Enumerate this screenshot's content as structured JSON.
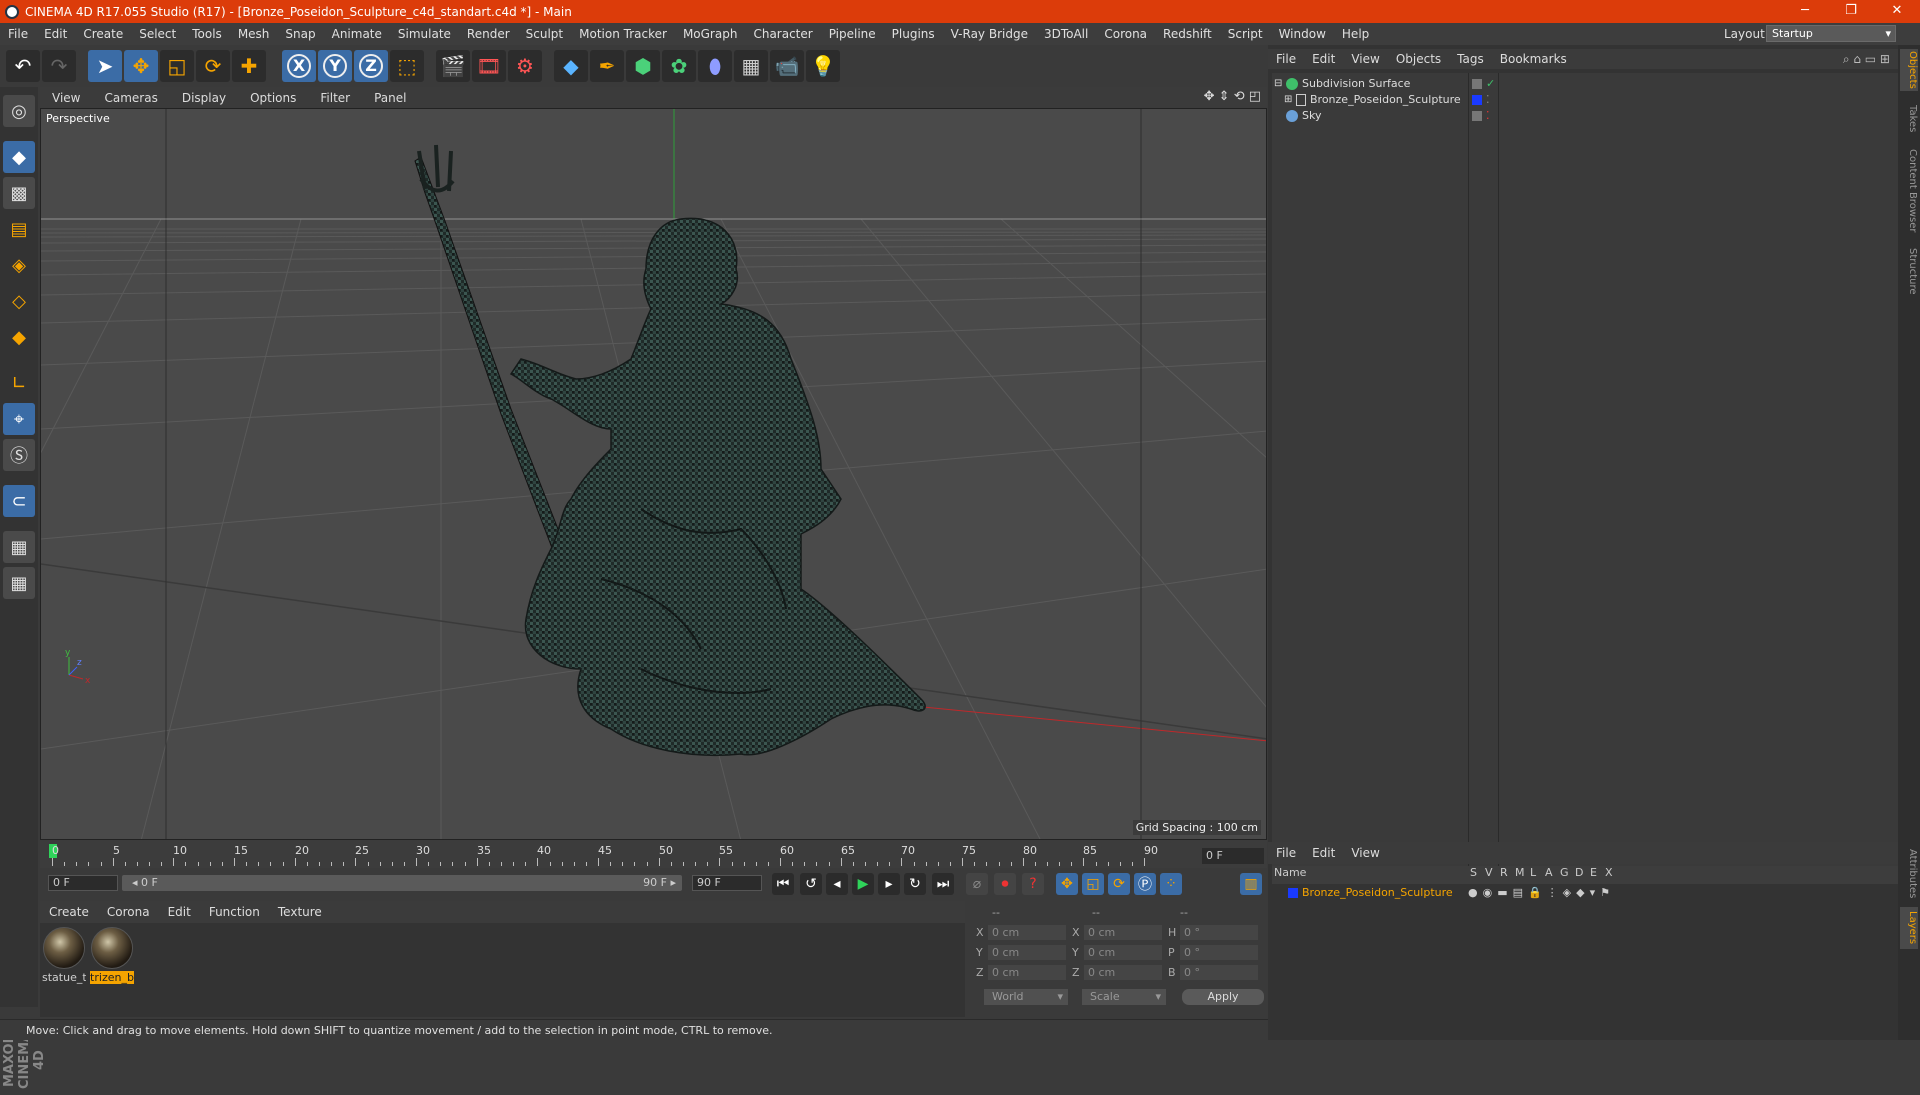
{
  "window": {
    "title": "CINEMA 4D R17.055 Studio (R17) - [Bronze_Poseidon_Sculpture_c4d_standart.c4d *] - Main",
    "minimize": "─",
    "maximize": "❐",
    "close": "✕"
  },
  "menu": [
    "File",
    "Edit",
    "Create",
    "Select",
    "Tools",
    "Mesh",
    "Snap",
    "Animate",
    "Simulate",
    "Render",
    "Sculpt",
    "Motion Tracker",
    "MoGraph",
    "Character",
    "Pipeline",
    "Plugins",
    "V-Ray Bridge",
    "3DToAll",
    "Corona",
    "Redshift",
    "Script",
    "Window",
    "Help"
  ],
  "layout": {
    "label": "Layout:",
    "value": "Startup"
  },
  "viewport": {
    "menu": [
      "View",
      "Cameras",
      "Display",
      "Options",
      "Filter",
      "Panel"
    ],
    "label": "Perspective",
    "grid_spacing": "Grid Spacing : 100 cm"
  },
  "timeline": {
    "ticks": [
      "0",
      "5",
      "10",
      "15",
      "20",
      "25",
      "30",
      "35",
      "40",
      "45",
      "50",
      "55",
      "60",
      "65",
      "70",
      "75",
      "80",
      "85",
      "90"
    ],
    "end_field": "0 F",
    "current": "0 F",
    "range_start": "◂ 0 F",
    "range_end": "90 F ▸",
    "max_field": "90 F"
  },
  "materials": {
    "menu": [
      "Create",
      "Corona",
      "Edit",
      "Function",
      "Texture"
    ],
    "items": [
      {
        "name": "statue_t",
        "selected": false
      },
      {
        "name": "trizen_b",
        "selected": true
      }
    ]
  },
  "coords": {
    "header": [
      "--",
      "--",
      "--"
    ],
    "rows": [
      {
        "a": "X",
        "av": "0 cm",
        "b": "X",
        "bv": "0 cm",
        "c": "H",
        "cv": "0 °"
      },
      {
        "a": "Y",
        "av": "0 cm",
        "b": "Y",
        "bv": "0 cm",
        "c": "P",
        "cv": "0 °"
      },
      {
        "a": "Z",
        "av": "0 cm",
        "b": "Z",
        "bv": "0 cm",
        "c": "B",
        "cv": "0 °"
      }
    ],
    "space": "World",
    "mode": "Scale",
    "apply": "Apply"
  },
  "objects": {
    "menu": [
      "File",
      "Edit",
      "View",
      "Objects",
      "Tags",
      "Bookmarks"
    ],
    "tree": [
      {
        "name": "Subdivision Surface",
        "color": "#3fbf6a"
      },
      {
        "name": "Bronze_Poseidon_Sculpture",
        "color": "#1a3aff"
      },
      {
        "name": "Sky",
        "color": "#6aa0d8"
      }
    ]
  },
  "layers": {
    "menu": [
      "File",
      "Edit",
      "View"
    ],
    "columns": [
      "Name",
      "S",
      "V",
      "R",
      "M",
      "L",
      "A",
      "G",
      "D",
      "E",
      "X"
    ],
    "row": "Bronze_Poseidon_Sculpture"
  },
  "sidetabs": [
    "Objects",
    "Takes",
    "Content Browser",
    "Structure",
    "Attributes",
    "Layers"
  ],
  "status": "Move: Click and drag to move elements. Hold down SHIFT to quantize movement / add to the selection in point mode, CTRL to remove.",
  "maxon": "MAXON CINEMA 4D"
}
